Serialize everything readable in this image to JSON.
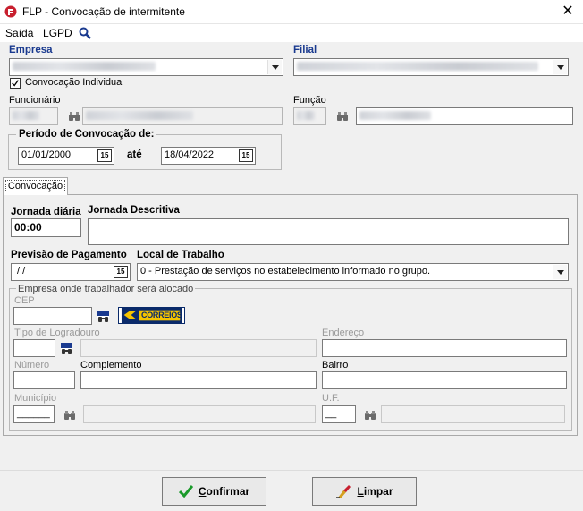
{
  "window": {
    "title": "FLP - Convocação de intermitente",
    "close_glyph": "✕"
  },
  "menu": {
    "saida": "Saída",
    "lgpd": "LGPD"
  },
  "empresa": {
    "label": "Empresa"
  },
  "filial": {
    "label": "Filial"
  },
  "convocacao_individual": {
    "label": "Convocação Individual",
    "checked": true
  },
  "funcionario": {
    "label": "Funcionário"
  },
  "funcao": {
    "label": "Função"
  },
  "periodo": {
    "label": "Período de Convocação de:",
    "de": "01/01/2000",
    "ate_label": "até",
    "ate": "18/04/2022",
    "cal_glyph": "15"
  },
  "tabs": [
    {
      "label": "Convocação"
    }
  ],
  "jornada": {
    "diaria_label": "Jornada diária",
    "diaria_value": "00:00",
    "descritiva_label": "Jornada Descritiva",
    "descritiva_value": ""
  },
  "previsao": {
    "label": "Previsão de Pagamento",
    "value": " / /"
  },
  "local_trabalho": {
    "label": "Local de Trabalho",
    "value": "0 - Prestação de serviços no estabelecimento informado no grupo."
  },
  "alocacao": {
    "group_label": "Empresa onde trabalhador será alocado",
    "cep_label": "CEP",
    "correios_text": "CORREIOS",
    "tipo_logradouro_label": "Tipo de Logradouro",
    "endereco_label": "Endereço",
    "numero_label": "Número",
    "complemento_label": "Complemento",
    "bairro_label": "Bairro",
    "municipio_label": "Município",
    "uf_label": "U.F.",
    "municipio_code": "______",
    "uf_value": "__"
  },
  "buttons": {
    "confirmar": "Confirmar",
    "limpar": "Limpar"
  },
  "colors": {
    "accent_label": "#1a3a8f",
    "window_bg": "#f0f0f0",
    "correios_blue": "#0a2a6a",
    "correios_yellow": "#f5c400",
    "confirm_green": "#1a9a2a"
  }
}
